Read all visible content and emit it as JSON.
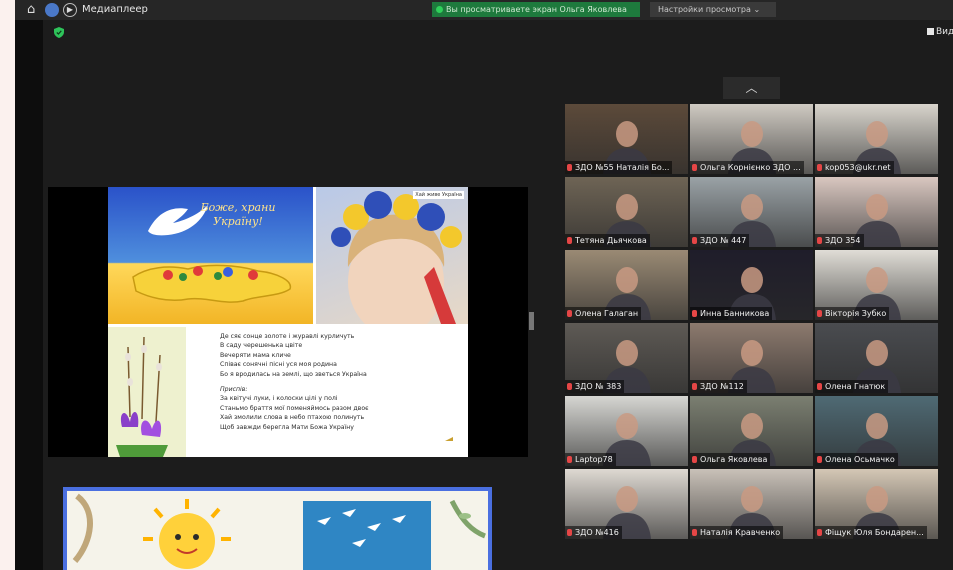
{
  "app": {
    "title": "Медиаплеер",
    "recording_text": "Вы просматриваете экран Ольга Яковлева",
    "view_options": "Настройки просмотра",
    "view_button": "Вид"
  },
  "slide": {
    "banner_title": "Боже, храни Україну!",
    "photo_caption": "Хай живе Україна",
    "poem_verse": [
      "Де сяє сонце золоте і журавлі курличуть",
      "В саду черешенька цвіте",
      "Вечеряти мама кличе",
      "Співає сонячні пісні уся моя родина",
      "Бо я вродилась на землі, що зветься Україна"
    ],
    "refrain_label": "Приспів:",
    "poem_refrain": [
      "За квітучі луки, і колоски цілі у полі",
      "Станьмо браття мої поменяймось разом двоє",
      "Хай змолили слова в небо птахою полинуть",
      "Щоб завжди берегла Мати Божа Україну"
    ]
  },
  "gallery": {
    "collapse_icon": "chevron-up-icon",
    "participants": [
      {
        "name": "ЗДО №55 Наталія Бо...",
        "scene": "#5c4a3a"
      },
      {
        "name": "Ольга Корнієнко ЗДО ...",
        "scene": "#cfcac2"
      },
      {
        "name": "kop053@ukr.net",
        "scene": "#d8d4cc"
      },
      {
        "name": "Тетяна Дьячкова",
        "scene": "#6e6455"
      },
      {
        "name": "ЗДО № 447",
        "scene": "#9aa2a6"
      },
      {
        "name": "ЗДО 354",
        "scene": "#d9c7c0"
      },
      {
        "name": "Олена Галаган",
        "scene": "#9a8a74"
      },
      {
        "name": "Инна Банникова",
        "scene": "#1f1d2a"
      },
      {
        "name": "Вікторія Зубко",
        "scene": "#e0ddd6"
      },
      {
        "name": "ЗДО № 383",
        "scene": "#5e5a55"
      },
      {
        "name": "ЗДО №112",
        "scene": "#8d7a6e"
      },
      {
        "name": "Олена Гнатюк",
        "scene": "#4a4c50"
      },
      {
        "name": "Laptop78",
        "scene": "#d6d6d2"
      },
      {
        "name": "Ольга Яковлева",
        "scene": "#7b7f71"
      },
      {
        "name": "Олена Осьмачко",
        "scene": "#4f6a74"
      },
      {
        "name": "ЗДО №416",
        "scene": "#ded9d2"
      },
      {
        "name": "Наталія Кравченко",
        "scene": "#c9c1b8"
      },
      {
        "name": "Фіщук Юля Бондарен...",
        "scene": "#d4c7b5"
      }
    ],
    "active_index": 13
  }
}
